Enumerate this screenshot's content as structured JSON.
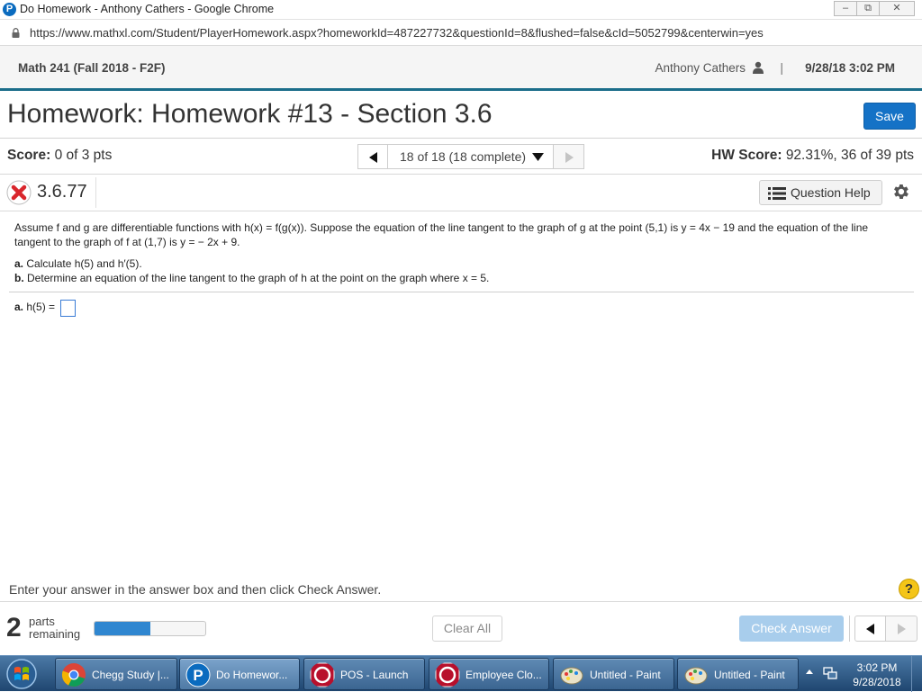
{
  "window": {
    "title": "Do Homework - Anthony Cathers - Google Chrome",
    "app_icon": "P",
    "buttons": {
      "minimize": "‒",
      "restore": "⧉",
      "close": "✕"
    }
  },
  "address": {
    "url": "https://www.mathxl.com/Student/PlayerHomework.aspx?homeworkId=487227732&questionId=8&flushed=false&cId=5052799&centerwin=yes"
  },
  "course": {
    "name": "Math 241 (Fall 2018 - F2F)",
    "user": "Anthony Cathers",
    "separator": "|",
    "datetime": "9/28/18 3:02 PM"
  },
  "homework": {
    "title": "Homework: Homework #13 - Section 3.6",
    "save_label": "Save"
  },
  "score": {
    "label": "Score:",
    "value": "0 of 3 pts",
    "hw_label": "HW Score:",
    "hw_value": "92.31%, 36 of 39 pts"
  },
  "navigator": {
    "current": "18 of 18 (18 complete)"
  },
  "question": {
    "number": "3.6.77",
    "help_label": "Question Help",
    "text": "Assume f and g are differentiable functions with h(x) = f(g(x)). Suppose the equation of the line tangent to the graph of g at the point (5,1) is y = 4x − 19 and the equation of the line tangent to the graph of f at (1,7) is y = − 2x + 9.",
    "part_a_label": "a.",
    "part_a_text": "Calculate h(5) and h′(5).",
    "part_b_label": "b.",
    "part_b_text": "Determine an equation of the line tangent to the graph of h at the point on the graph where x = 5.",
    "answer_label": "a.",
    "answer_prompt": "h(5) ="
  },
  "instructions": "Enter your answer in the answer box and then click Check Answer.",
  "help_symbol": "?",
  "footer": {
    "parts_count": "2",
    "parts_word": "parts",
    "remaining_word": "remaining",
    "progress_fraction": 0.5,
    "clear_label": "Clear All",
    "check_label": "Check Answer"
  },
  "taskbar": {
    "items": [
      {
        "label": "Chegg Study |...",
        "icon": "chrome-icon"
      },
      {
        "label": "Do Homewor...",
        "icon": "pearson-icon"
      },
      {
        "label": "POS - Launch",
        "icon": "app-icon"
      },
      {
        "label": "Employee Clo...",
        "icon": "app-icon"
      },
      {
        "label": "Untitled - Paint",
        "icon": "paint-icon"
      },
      {
        "label": "Untitled - Paint",
        "icon": "paint-icon"
      }
    ],
    "time": "3:02 PM",
    "date": "9/28/2018"
  },
  "colors": {
    "accent": "#1572c6",
    "header_rule": "#1b6d8a",
    "error": "#d9262c"
  }
}
